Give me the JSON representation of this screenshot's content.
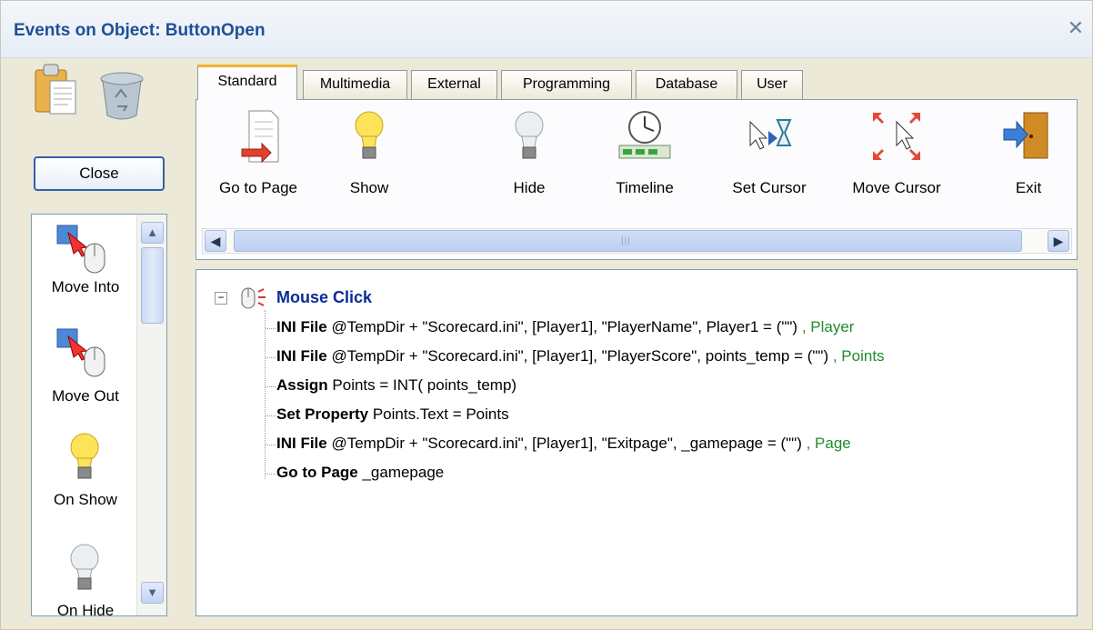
{
  "window": {
    "title": "Events on Object: ButtonOpen",
    "close_glyph": "✕"
  },
  "left_panel": {
    "icons": [
      "clipboard-icon",
      "recycle-bin-icon"
    ],
    "close_button": "Close",
    "events": [
      {
        "label": "Move Into",
        "icon": "mouse-move-into-icon"
      },
      {
        "label": "Move Out",
        "icon": "mouse-move-out-icon"
      },
      {
        "label": "On Show",
        "icon": "lightbulb-on-icon"
      },
      {
        "label": "On Hide",
        "icon": "lightbulb-off-icon"
      }
    ],
    "scroll_up": "▲",
    "scroll_down": "▼"
  },
  "tabs": [
    {
      "label": "Standard",
      "active": true
    },
    {
      "label": "Multimedia"
    },
    {
      "label": "External"
    },
    {
      "label": "Programming"
    },
    {
      "label": "Database"
    },
    {
      "label": "User"
    }
  ],
  "tools": [
    {
      "label": "Go to Page",
      "icon": "document-arrow-icon"
    },
    {
      "label": "Show",
      "icon": "lightbulb-on-icon"
    },
    {
      "label": "Hide",
      "icon": "lightbulb-off-icon"
    },
    {
      "label": "Timeline",
      "icon": "clock-timeline-icon"
    },
    {
      "label": "Set Cursor",
      "icon": "cursor-hourglass-icon"
    },
    {
      "label": "Move Cursor",
      "icon": "move-cursor-icon"
    },
    {
      "label": "Exit",
      "icon": "exit-door-icon"
    }
  ],
  "hscroll": {
    "left": "◀",
    "right": "▶",
    "grip": "|||"
  },
  "actions": {
    "root": "Mouse Click",
    "expander": "−",
    "items": [
      {
        "cmd": "INI File",
        "args": " @TempDir + \"Scorecard.ini\", [Player1], \"PlayerName\", Player1 = (\"\") ",
        "var": ", Player"
      },
      {
        "cmd": "INI File",
        "args": " @TempDir + \"Scorecard.ini\", [Player1], \"PlayerScore\", points_temp = (\"\") ",
        "var": ", Points"
      },
      {
        "cmd": "Assign",
        "args": " Points = INT( points_temp)",
        "var": ""
      },
      {
        "cmd": "Set Property",
        "args": " Points.Text = Points",
        "var": ""
      },
      {
        "cmd": "INI File",
        "args": " @TempDir + \"Scorecard.ini\", [Player1], \"Exitpage\", _gamepage = (\"\") ",
        "var": ", Page"
      },
      {
        "cmd": "Go to Page",
        "args": " _gamepage",
        "var": ""
      }
    ]
  }
}
